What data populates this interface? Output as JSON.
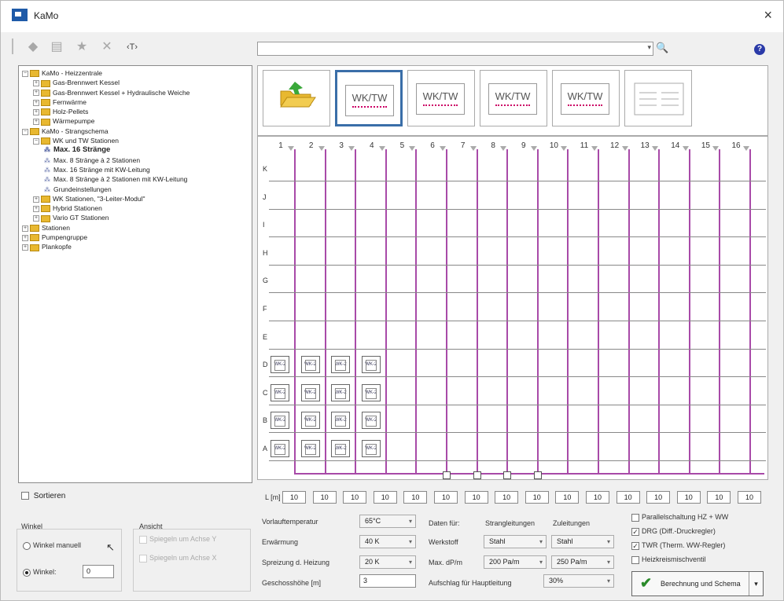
{
  "window": {
    "title": "KaMo",
    "close_glyph": "×"
  },
  "toolbar": {
    "icons": [
      "grip-icon",
      "plus-icon",
      "list-icon",
      "star-icon",
      "delete-icon",
      "rename-icon"
    ]
  },
  "search": {
    "value": "",
    "search_glyph": "🔍",
    "help_glyph": "?"
  },
  "tree": [
    {
      "label": "KaMo - Heizzentrale",
      "level": 0,
      "type": "folder",
      "exp": "−"
    },
    {
      "label": "Gas-Brennwert Kessel",
      "level": 1,
      "type": "folder",
      "exp": "+"
    },
    {
      "label": "Gas-Brennwert Kessel + Hydraulische Weiche",
      "level": 1,
      "type": "folder",
      "exp": "+"
    },
    {
      "label": "Fernwärme",
      "level": 1,
      "type": "folder",
      "exp": "+"
    },
    {
      "label": "Holz-Pellets",
      "level": 1,
      "type": "folder",
      "exp": "+"
    },
    {
      "label": "Wärmepumpe",
      "level": 1,
      "type": "folder",
      "exp": "+"
    },
    {
      "label": "KaMo - Strangschema",
      "level": 0,
      "type": "folder",
      "exp": "−"
    },
    {
      "label": "WK und TW Stationen",
      "level": 1,
      "type": "folder",
      "exp": "−"
    },
    {
      "label": "Max. 16 Stränge",
      "level": 2,
      "type": "leaf",
      "bold": true
    },
    {
      "label": "Max. 8 Stränge à 2 Stationen",
      "level": 2,
      "type": "leaf"
    },
    {
      "label": "Max. 16 Stränge mit KW-Leitung",
      "level": 2,
      "type": "leaf"
    },
    {
      "label": "Max. 8 Stränge à 2 Stationen mit KW-Leitung",
      "level": 2,
      "type": "leaf"
    },
    {
      "label": "Grundeinstellungen",
      "level": 2,
      "type": "leaf"
    },
    {
      "label": "WK Stationen, \"3-Leiter-Modul\"",
      "level": 1,
      "type": "folder",
      "exp": "+"
    },
    {
      "label": "Hybrid Stationen",
      "level": 1,
      "type": "folder",
      "exp": "+"
    },
    {
      "label": "Vario GT Stationen",
      "level": 1,
      "type": "folder",
      "exp": "+"
    },
    {
      "label": "Stationen",
      "level": 0,
      "type": "folder",
      "exp": "+"
    },
    {
      "label": "Pumpengruppe",
      "level": 0,
      "type": "folder",
      "exp": "+"
    },
    {
      "label": "Plankopfe",
      "level": 0,
      "type": "folder",
      "exp": "+"
    }
  ],
  "sort": {
    "label": "Sortieren"
  },
  "thumbs": [
    "WK/TW",
    "WK/TW",
    "WK/TW",
    "WK/TW"
  ],
  "grid": {
    "columns": [
      "1",
      "2",
      "3",
      "4",
      "5",
      "6",
      "7",
      "8",
      "9",
      "10",
      "11",
      "12",
      "13",
      "14",
      "15",
      "16"
    ],
    "rows": [
      "K",
      "J",
      "I",
      "H",
      "G",
      "F",
      "E",
      "D",
      "C",
      "B",
      "A"
    ],
    "station_label": "WK-2",
    "l_label": "L [m]",
    "l_values": [
      "10",
      "10",
      "10",
      "10",
      "10",
      "10",
      "10",
      "10",
      "10",
      "10",
      "10",
      "10",
      "10",
      "10",
      "10",
      "10"
    ]
  },
  "winkel": {
    "title": "Winkel",
    "manual_label": "Winkel manuell",
    "angle_label": "Winkel:",
    "angle_value": "0"
  },
  "ansicht": {
    "title": "Ansicht",
    "opt1": "Spiegeln um Achse Y",
    "opt2": "Spiegeln um Achse X"
  },
  "params": {
    "vorlauf_label": "Vorlauftemperatur",
    "vorlauf_value": "65°C",
    "erwaermung_label": "Erwärmung",
    "erwaermung_value": "40 K",
    "spreizung_label": "Spreizung d. Heizung",
    "spreizung_value": "20 K",
    "geschoss_label": "Geschosshöhe [m]",
    "geschoss_value": "3"
  },
  "daten": {
    "label": "Daten für:",
    "col1": "Strangleitungen",
    "col2": "Zuleitungen",
    "werkstoff_label": "Werkstoff",
    "werkstoff1": "Stahl",
    "werkstoff2": "Stahl",
    "dp_label": "Max. dP/m",
    "dp1": "200 Pa/m",
    "dp2": "250 Pa/m",
    "aufschlag_label": "Aufschlag für Hauptleitung",
    "aufschlag_value": "30%"
  },
  "options": {
    "opt1": "Parallelschaltung HZ + WW",
    "opt2": "DRG (Diff.-Druckregler)",
    "opt3": "TWR (Therm. WW-Regler)",
    "opt4": "Heizkreismischventil"
  },
  "calc_button": {
    "label": "Berechnung und Schema",
    "check_glyph": "✔",
    "split_glyph": "▾"
  }
}
